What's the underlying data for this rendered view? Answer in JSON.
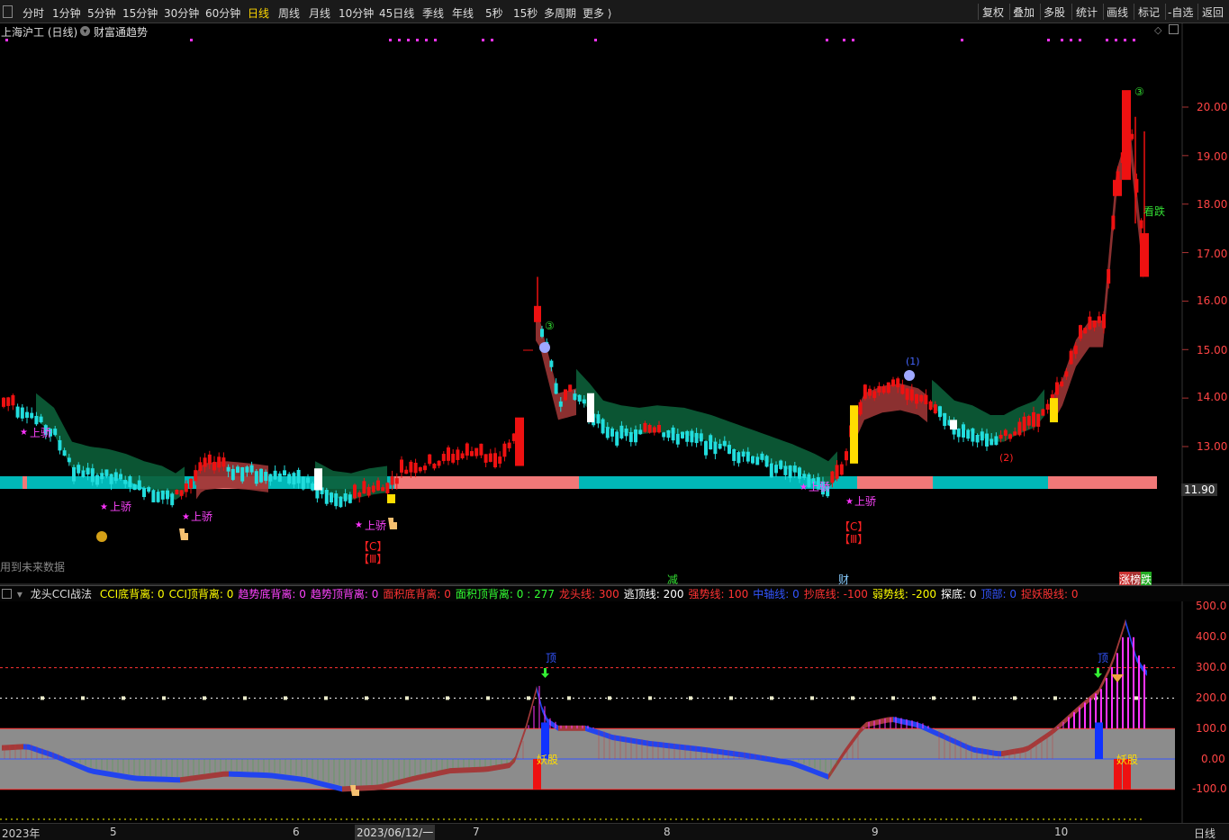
{
  "toolbar": {
    "periods": [
      "分时",
      "1分钟",
      "5分钟",
      "15分钟",
      "30分钟",
      "60分钟",
      "日线",
      "周线",
      "月线",
      "10分钟",
      "45日线",
      "季线",
      "年线",
      "5秒",
      "15秒",
      "多周期",
      "更多 ⟩"
    ],
    "active_period": "日线",
    "tools": [
      "复权",
      "叠加",
      "多股",
      "统计",
      "画线",
      "标记",
      "-自选",
      "返回"
    ]
  },
  "main_chart": {
    "stock_title": "上海沪工 (日线)",
    "indicator_name": "财富通趋势",
    "price_axis": [
      "20.00",
      "19.00",
      "18.00",
      "17.00",
      "16.00",
      "15.00",
      "14.00",
      "13.00"
    ],
    "current_price": "11.90",
    "future_data_note": "用到未来数据",
    "signal_labels": {
      "shangjiao": "上骄",
      "c_mark": "【C】",
      "iii_mark": "【Ⅲ】",
      "circled_three": "③",
      "paren_one": "(1)",
      "paren_two": "(2)",
      "kan_die": "看跌",
      "jian": "减",
      "cai": "财",
      "zhang": "涨",
      "bang": "榜",
      "die": "跌"
    }
  },
  "sub_chart": {
    "title": "龙头CCI战法",
    "params": [
      {
        "text": "CCI底背离: 0",
        "color": "#ffff00"
      },
      {
        "text": "CCI顶背离: 0",
        "color": "#ffff00"
      },
      {
        "text": "趋势底背离: 0",
        "color": "#ff44ff"
      },
      {
        "text": "趋势顶背离: 0",
        "color": "#ff44ff"
      },
      {
        "text": "面积底背离: 0",
        "color": "#ff3333"
      },
      {
        "text": "面积顶背离: 0 : 277",
        "color": "#33ff33"
      },
      {
        "text": "龙头线: 300",
        "color": "#ff3333"
      },
      {
        "text": "逃顶线: 200",
        "color": "#ffffff"
      },
      {
        "text": "强势线: 100",
        "color": "#ff3333"
      },
      {
        "text": "中轴线: 0",
        "color": "#3355ff"
      },
      {
        "text": "抄底线: -100",
        "color": "#ff3333"
      },
      {
        "text": "弱势线: -200",
        "color": "#ffff00"
      },
      {
        "text": "探底: 0",
        "color": "#ffffff"
      },
      {
        "text": "顶部: 0",
        "color": "#3355ff"
      },
      {
        "text": "捉妖股线: 0",
        "color": "#ff3333"
      }
    ],
    "axis": [
      "500.0",
      "400.0",
      "300.0",
      "200.0",
      "100.0",
      "0.00",
      "-100.0"
    ],
    "labels": {
      "ding": "顶",
      "yaogu": "妖股"
    }
  },
  "x_axis": {
    "labels": [
      "2023年",
      "5",
      "6",
      "7",
      "8",
      "9",
      "10"
    ],
    "cursor_date": "2023/06/12/一",
    "unit": "日线"
  },
  "colors": {
    "up": "#ee1111",
    "down": "#22dddd",
    "cloud_up": "#9a3535",
    "cloud_down": "#0c5e38",
    "band_cyan": "#00b8b8",
    "band_pink": "#f07878",
    "magenta": "#ff33ff"
  }
}
